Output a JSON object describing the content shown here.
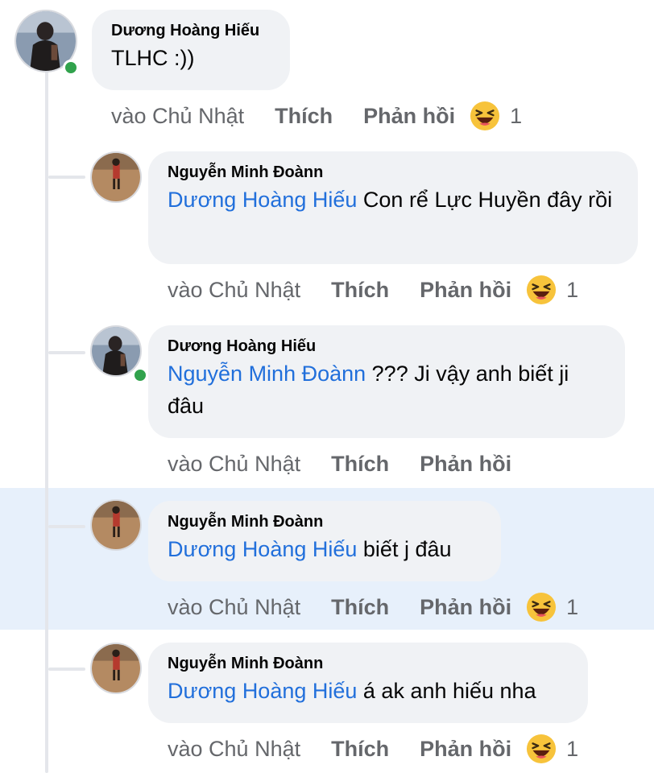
{
  "colors": {
    "mention": "#216fdb",
    "bubble": "#f0f2f5",
    "online": "#31a24c",
    "highlight_row": "#e7f0fb",
    "meta_text": "#65676b"
  },
  "comments": [
    {
      "author": "Dương Hoàng Hiếu",
      "mention": "",
      "text": "TLHC :))",
      "time": "vào Chủ Nhật",
      "like_label": "Thích",
      "reply_label": "Phản hồi",
      "reaction_icon": "laughing-emoji-icon",
      "reaction_count": "1",
      "online": true
    },
    {
      "author": "Nguyễn Minh Đoànn",
      "mention": "Dương Hoàng Hiếu",
      "text": " Con rể Lực Huyền đây rồi",
      "time": "vào Chủ Nhật",
      "like_label": "Thích",
      "reply_label": "Phản hồi",
      "reaction_icon": "laughing-emoji-icon",
      "reaction_count": "1",
      "online": false
    },
    {
      "author": "Dương Hoàng Hiếu",
      "mention": "Nguyễn Minh Đoànn",
      "text": " ??? Ji vậy anh biết ji đâu",
      "time": "vào Chủ Nhật",
      "like_label": "Thích",
      "reply_label": "Phản hồi",
      "reaction_icon": "",
      "reaction_count": "",
      "online": true
    },
    {
      "author": "Nguyễn Minh Đoànn",
      "mention": "Dương Hoàng Hiếu",
      "text": " biết j đâu",
      "time": "vào Chủ Nhật",
      "like_label": "Thích",
      "reply_label": "Phản hồi",
      "reaction_icon": "laughing-emoji-icon",
      "reaction_count": "1",
      "online": false,
      "highlighted": true
    },
    {
      "author": "Nguyễn Minh Đoànn",
      "mention": "Dương Hoàng Hiếu",
      "text": " á ak anh hiếu nha",
      "time": "vào Chủ Nhật",
      "like_label": "Thích",
      "reply_label": "Phản hồi",
      "reaction_icon": "laughing-emoji-icon",
      "reaction_count": "1",
      "online": false
    }
  ]
}
